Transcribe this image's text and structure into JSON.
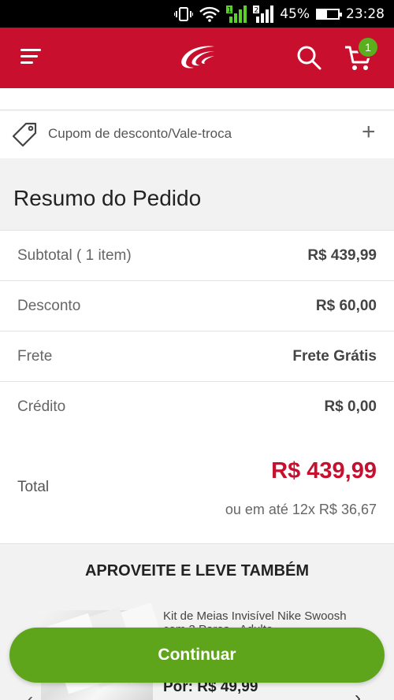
{
  "status_bar": {
    "battery": "45%",
    "time": "23:28",
    "sim1": "1",
    "sim2": "2"
  },
  "header": {
    "cart_count": "1",
    "brand_color": "#c8102e"
  },
  "coupon": {
    "label": "Cupom de desconto/Vale-troca",
    "expand": "+"
  },
  "summary": {
    "title": "Resumo do Pedido",
    "rows": [
      {
        "label": "Subtotal ( 1 item)",
        "value": "R$ 439,99"
      },
      {
        "label": "Desconto",
        "value": "R$ 60,00"
      },
      {
        "label": "Frete",
        "value": "Frete Grátis"
      },
      {
        "label": "Crédito",
        "value": "R$ 0,00"
      }
    ],
    "total_label": "Total",
    "total_value": "R$ 439,99",
    "installments": "ou em até 12x R$ 36,67"
  },
  "recommendations": {
    "title": "APROVEITE E LEVE TAMBÉM",
    "item_name": "Kit de Meias Invisível Nike Swoosh com 3 Pares - Adulto",
    "item_price": "Por: R$ 49,99"
  },
  "continue_label": "Continuar",
  "accent_color": "#5fa51c"
}
